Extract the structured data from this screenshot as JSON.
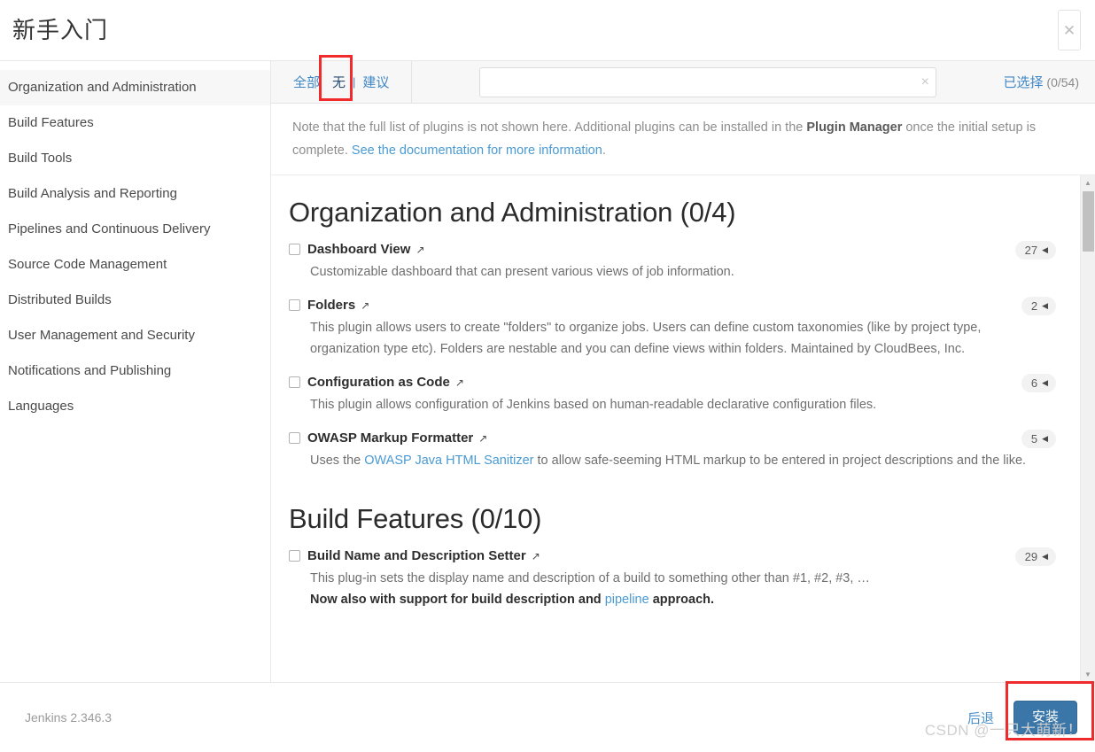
{
  "header": {
    "title": "新手入门",
    "close_icon": "close-icon"
  },
  "sidebar": {
    "items": [
      {
        "label": "Organization and Administration",
        "active": true
      },
      {
        "label": "Build Features",
        "active": false
      },
      {
        "label": "Build Tools",
        "active": false
      },
      {
        "label": "Build Analysis and Reporting",
        "active": false
      },
      {
        "label": "Pipelines and Continuous Delivery",
        "active": false
      },
      {
        "label": "Source Code Management",
        "active": false
      },
      {
        "label": "Distributed Builds",
        "active": false
      },
      {
        "label": "User Management and Security",
        "active": false
      },
      {
        "label": "Notifications and Publishing",
        "active": false
      },
      {
        "label": "Languages",
        "active": false
      }
    ]
  },
  "toolbar": {
    "tabs": [
      {
        "label": "全部",
        "selected": false
      },
      {
        "label": "无",
        "selected": true
      },
      {
        "label": "建议",
        "selected": false
      }
    ],
    "tab_separator": "|",
    "search": {
      "value": "",
      "placeholder": "",
      "clear_icon": "×"
    },
    "selected_label": "已选择",
    "selected_count": "(0/54)"
  },
  "note": {
    "part1": "Note that the full list of plugins is not shown here. Additional plugins can be installed in the ",
    "bold": "Plugin Manager",
    "part2": " once the initial setup is complete. ",
    "link": "See the documentation for more information",
    "part3": "."
  },
  "categories": [
    {
      "title": "Organization and Administration (0/4)",
      "plugins": [
        {
          "name": "Dashboard View",
          "checked": false,
          "badge": "27",
          "badge_caret": "◀",
          "ext_icon": "↗",
          "desc_parts": [
            {
              "type": "text",
              "text": "Customizable dashboard that can present various views of job information."
            }
          ]
        },
        {
          "name": "Folders",
          "checked": false,
          "badge": "2",
          "badge_caret": "◀",
          "ext_icon": "↗",
          "desc_parts": [
            {
              "type": "text",
              "text": "This plugin allows users to create \"folders\" to organize jobs. Users can define custom taxonomies (like by project type, organization type etc). Folders are nestable and you can define views within folders. Maintained by CloudBees, Inc."
            }
          ]
        },
        {
          "name": "Configuration as Code",
          "checked": false,
          "badge": "6",
          "badge_caret": "◀",
          "ext_icon": "↗",
          "desc_parts": [
            {
              "type": "text",
              "text": "This plugin allows configuration of Jenkins based on human-readable declarative configuration files."
            }
          ]
        },
        {
          "name": "OWASP Markup Formatter",
          "checked": false,
          "badge": "5",
          "badge_caret": "◀",
          "ext_icon": "↗",
          "desc_parts": [
            {
              "type": "text",
              "text": "Uses the "
            },
            {
              "type": "link",
              "text": "OWASP Java HTML Sanitizer"
            },
            {
              "type": "text",
              "text": " to allow safe-seeming HTML markup to be entered in project descriptions and the like."
            }
          ]
        }
      ]
    },
    {
      "title": "Build Features (0/10)",
      "plugins": [
        {
          "name": "Build Name and Description Setter",
          "checked": false,
          "badge": "29",
          "badge_caret": "◀",
          "ext_icon": "↗",
          "desc_parts": [
            {
              "type": "text",
              "text": "This plug-in sets the display name and description of a build to something other than #1, #2, #3, …"
            },
            {
              "type": "br"
            },
            {
              "type": "bold",
              "text": "Now also with support for build description and "
            },
            {
              "type": "link",
              "text": "pipeline"
            },
            {
              "type": "bold",
              "text": " approach."
            }
          ]
        }
      ]
    }
  ],
  "scrollbar": {
    "up_icon": "▲",
    "down_icon": "▼"
  },
  "footer": {
    "version": "Jenkins 2.346.3",
    "back_label": "后退",
    "install_label": "安装"
  },
  "watermark": "CSDN @一只大萌新！",
  "colors": {
    "accent_blue": "#3f87c7",
    "install_button": "#3a76a8",
    "annotation_red": "#ef2b2b",
    "link_blue": "#4a9ad4"
  }
}
